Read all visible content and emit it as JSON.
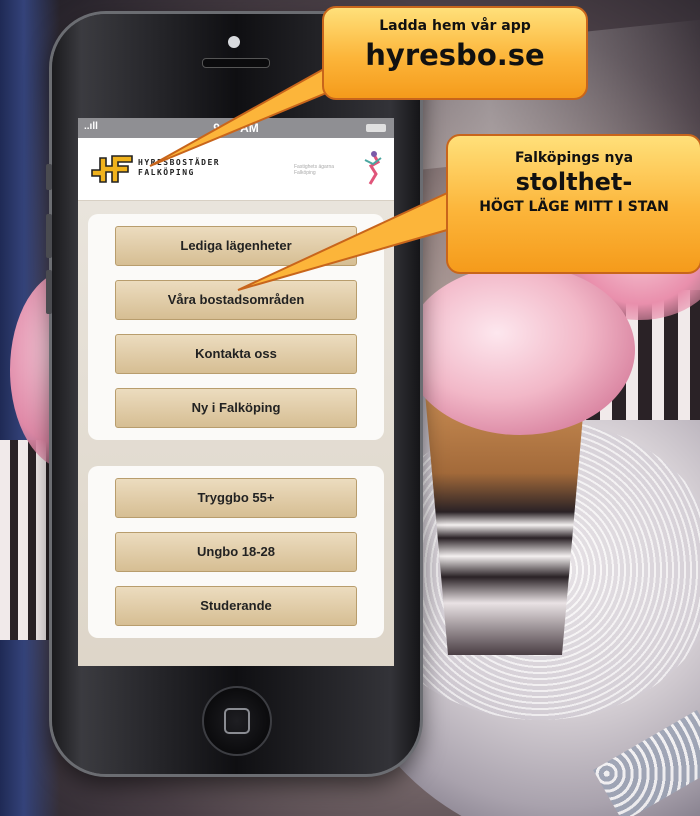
{
  "phone": {
    "status_bar": {
      "signal": "..ıll",
      "time": "9:20 AM"
    },
    "header": {
      "logo_line1": "HYRESBOSTÄDER",
      "logo_line2": "FALKÖPING",
      "partner_text": "Fastighets ägarna Falköping"
    },
    "menu_group_1": [
      {
        "label": "Lediga lägenheter"
      },
      {
        "label": "Våra bostadsområden"
      },
      {
        "label": "Kontakta oss"
      },
      {
        "label": "Ny i Falköping"
      }
    ],
    "menu_group_2": [
      {
        "label": "Tryggbo 55+"
      },
      {
        "label": "Ungbo 18-28"
      },
      {
        "label": "Studerande"
      }
    ]
  },
  "callouts": {
    "app": {
      "line1": "Ladda hem vår app",
      "line2": "hyresbo.se"
    },
    "pride": {
      "line1": "Falköpings nya",
      "line2": "stolthet-",
      "line3": "HÖGT LÄGE MITT I STAN"
    }
  },
  "colors": {
    "callout_fill": "#fcb53a",
    "callout_border": "#c8651b",
    "button_fill": "#ddc69d",
    "logo_yellow": "#f0b21c"
  },
  "icons": {
    "logo": "hf-logo-icon",
    "partner": "dancer-logo-icon",
    "home": "home-button-icon"
  }
}
